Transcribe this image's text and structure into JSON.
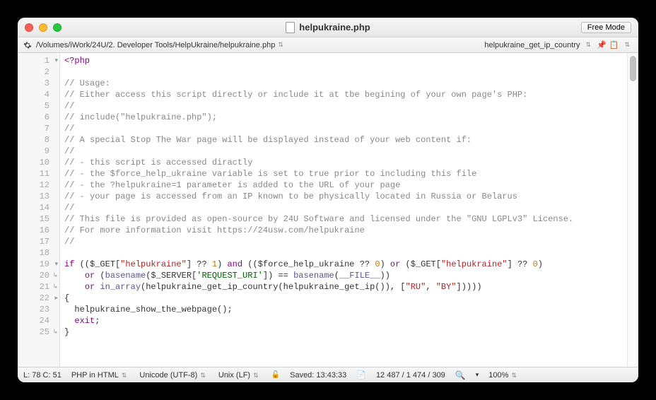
{
  "window": {
    "title": "helpukraine.php",
    "free_mode_label": "Free Mode"
  },
  "toolbar": {
    "path": "/Volumes/iWork/24U/2. Developer Tools/HelpUkraine/helpukraine.php",
    "symbol": "helpukraine_get_ip_country"
  },
  "code": {
    "lines": [
      {
        "n": 1,
        "fold": "▾",
        "tokens": [
          [
            "c-tag",
            "<?php"
          ]
        ]
      },
      {
        "n": 2,
        "tokens": []
      },
      {
        "n": 3,
        "tokens": [
          [
            "c-cm",
            "// Usage:"
          ]
        ]
      },
      {
        "n": 4,
        "tokens": [
          [
            "c-cm",
            "// Either access this script directly or include it at tbe begining of your own page's PHP:"
          ]
        ]
      },
      {
        "n": 5,
        "tokens": [
          [
            "c-cm",
            "//"
          ]
        ]
      },
      {
        "n": 6,
        "tokens": [
          [
            "c-cm",
            "// include(\"helpukraine.php\");"
          ]
        ]
      },
      {
        "n": 7,
        "tokens": [
          [
            "c-cm",
            "//"
          ]
        ]
      },
      {
        "n": 8,
        "tokens": [
          [
            "c-cm",
            "// A special Stop The War page will be displayed instead of your web content if:"
          ]
        ]
      },
      {
        "n": 9,
        "tokens": [
          [
            "c-cm",
            "//"
          ]
        ]
      },
      {
        "n": 10,
        "tokens": [
          [
            "c-cm",
            "// - this script is accessed diractly"
          ]
        ]
      },
      {
        "n": 11,
        "tokens": [
          [
            "c-cm",
            "// - the $force_help_ukraine variable is set to true prior to including this file"
          ]
        ]
      },
      {
        "n": 12,
        "tokens": [
          [
            "c-cm",
            "// - the ?helpukraine=1 parameter is added to the URL of your page"
          ]
        ]
      },
      {
        "n": 13,
        "tokens": [
          [
            "c-cm",
            "// - your page is accessed from an IP known to be physically located in Russia or Belarus"
          ]
        ]
      },
      {
        "n": 14,
        "tokens": [
          [
            "c-cm",
            "//"
          ]
        ]
      },
      {
        "n": 15,
        "tokens": [
          [
            "c-cm",
            "// This file is provided as open-source by 24U Software and licensed under the \"GNU LGPLv3\" License."
          ]
        ]
      },
      {
        "n": 16,
        "tokens": [
          [
            "c-cm",
            "// For more information visit https://24usw.com/helpukraine"
          ]
        ]
      },
      {
        "n": 17,
        "tokens": [
          [
            "c-cm",
            "//"
          ]
        ]
      },
      {
        "n": 18,
        "tokens": []
      },
      {
        "n": 19,
        "fold": "▾",
        "tokens": [
          [
            "c-kw",
            "if"
          ],
          [
            "",
            " (($_GET["
          ],
          [
            "c-rstr",
            "\"helpukraine\""
          ],
          [
            "",
            "] ?? "
          ],
          [
            "c-num",
            "1"
          ],
          [
            "",
            ") "
          ],
          [
            "c-kw",
            "and"
          ],
          [
            "",
            " (($force_help_ukraine ?? "
          ],
          [
            "c-num",
            "0"
          ],
          [
            "",
            ") "
          ],
          [
            "c-kw",
            "or"
          ],
          [
            "",
            " ($_GET["
          ],
          [
            "c-rstr",
            "\"helpukraine\""
          ],
          [
            "",
            "] ?? "
          ],
          [
            "c-num",
            "0"
          ],
          [
            "",
            ")"
          ]
        ]
      },
      {
        "n": 20,
        "fold": "↳",
        "tokens": [
          [
            "",
            "    "
          ],
          [
            "c-kw",
            "or"
          ],
          [
            "",
            " ("
          ],
          [
            "c-fn",
            "basename"
          ],
          [
            "",
            "($_SERVER["
          ],
          [
            "c-str",
            "'REQUEST_URI'"
          ],
          [
            "",
            "]) == "
          ],
          [
            "c-fn",
            "basename"
          ],
          [
            "",
            "("
          ],
          [
            "c-const",
            "__FILE__"
          ],
          [
            "",
            ")) "
          ]
        ]
      },
      {
        "n": 21,
        "fold": "↳",
        "tokens": [
          [
            "",
            "    "
          ],
          [
            "c-kw",
            "or"
          ],
          [
            "",
            " "
          ],
          [
            "c-fn",
            "in_array"
          ],
          [
            "",
            "(helpukraine_get_ip_country(helpukraine_get_ip()), ["
          ],
          [
            "c-rstr",
            "\"RU\""
          ],
          [
            "",
            ", "
          ],
          [
            "c-rstr",
            "\"BY\""
          ],
          [
            "",
            "]))))"
          ]
        ]
      },
      {
        "n": 22,
        "fold": "▸",
        "tokens": [
          [
            "",
            "{"
          ]
        ]
      },
      {
        "n": 23,
        "tokens": [
          [
            "",
            "  helpukraine_show_the_webpage();"
          ]
        ]
      },
      {
        "n": 24,
        "tokens": [
          [
            "",
            "  "
          ],
          [
            "c-kw",
            "exit"
          ],
          [
            "",
            ";"
          ]
        ]
      },
      {
        "n": 25,
        "fold": "↳",
        "tokens": [
          [
            "",
            "}"
          ]
        ]
      }
    ]
  },
  "status": {
    "pos": "L: 78 C: 51",
    "lang": "PHP in HTML",
    "enc": "Unicode (UTF-8)",
    "endings": "Unix (LF)",
    "saved": "Saved: 13:43:33",
    "stats": "12 487 / 1 474 / 309",
    "zoom": "100%"
  }
}
